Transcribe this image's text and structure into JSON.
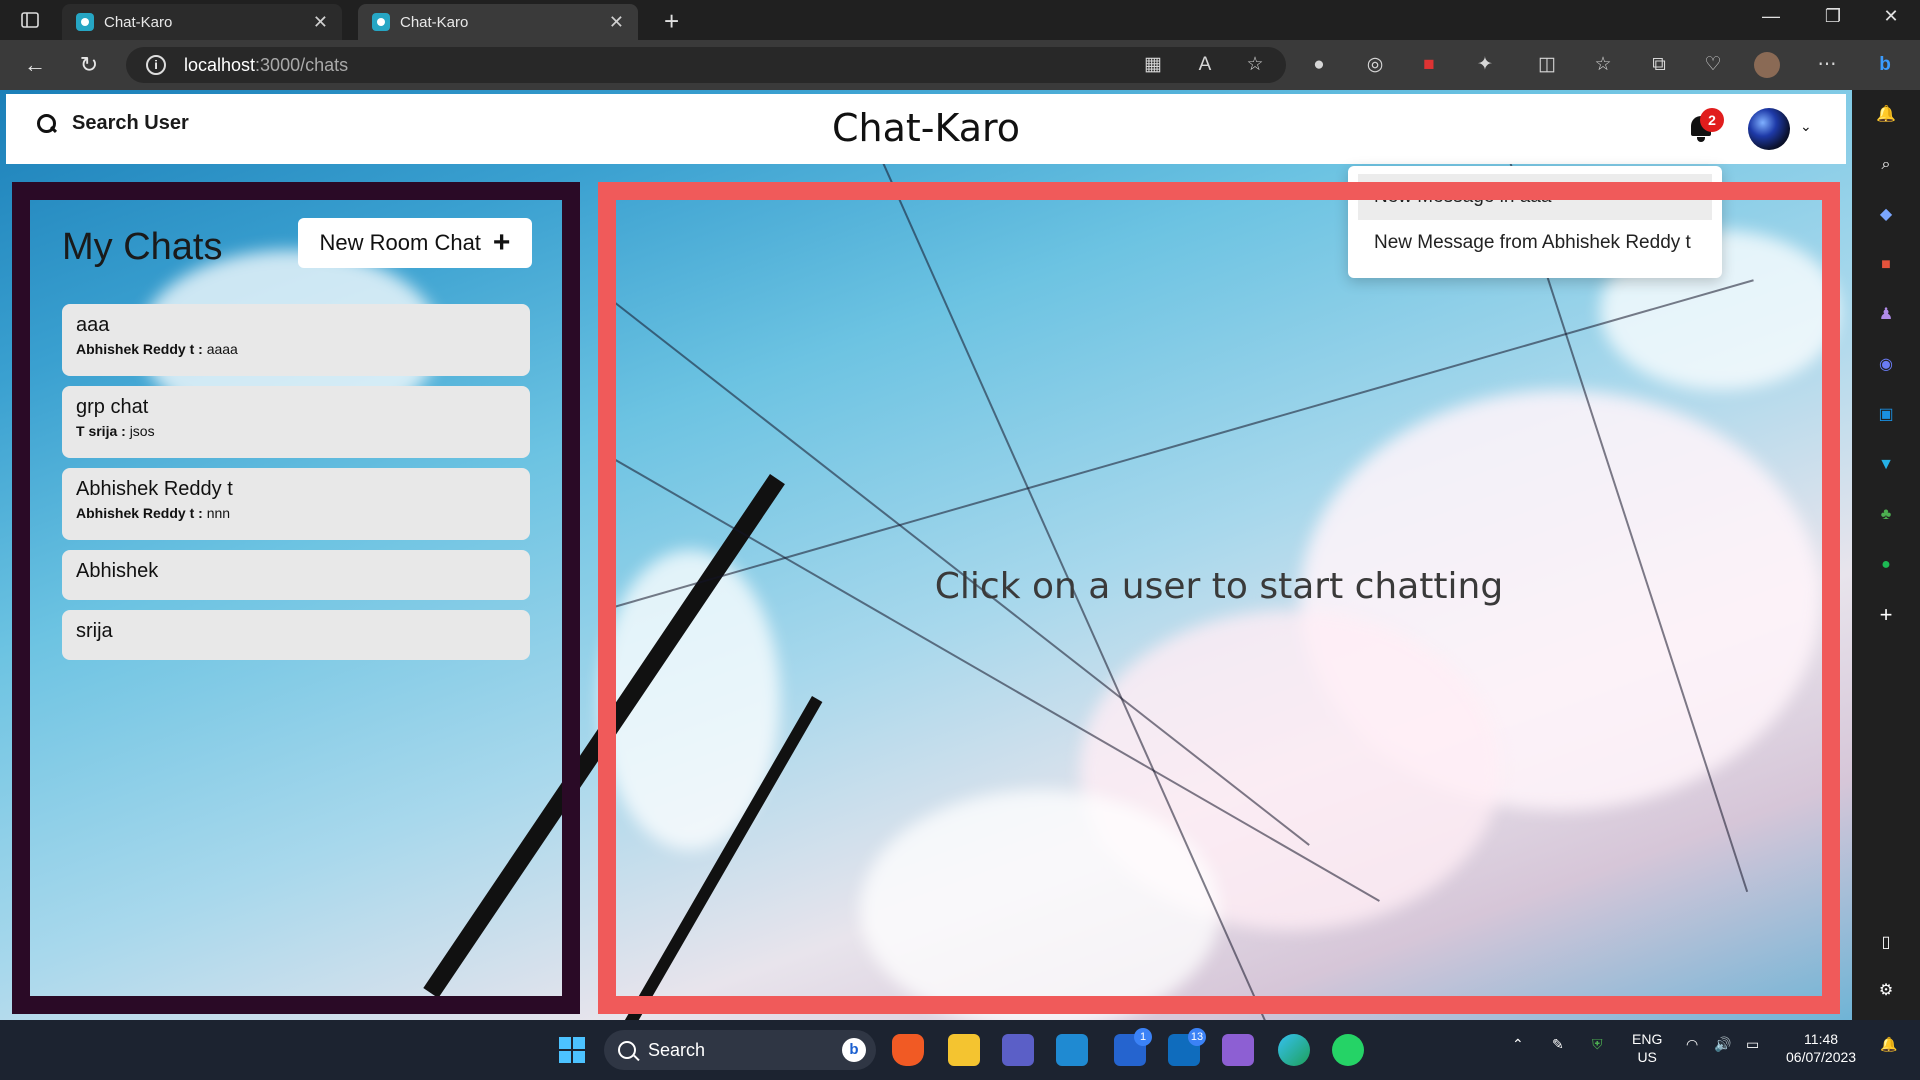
{
  "browser": {
    "tabs": [
      {
        "title": "Chat-Karo"
      },
      {
        "title": "Chat-Karo"
      }
    ],
    "url_host": "localhost",
    "url_path": ":3000/chats"
  },
  "header": {
    "search_label": "Search User",
    "brand": "Chat-Karo",
    "notification_count": "2"
  },
  "notifications": [
    {
      "text": "New Message in aaa"
    },
    {
      "text": "New Message from Abhishek Reddy t"
    }
  ],
  "sidebar": {
    "title": "My Chats",
    "new_room_label": "New Room Chat",
    "chats": [
      {
        "name": "aaa",
        "sender": "Abhishek Reddy t :",
        "message": "aaaa"
      },
      {
        "name": "grp chat",
        "sender": "T srija :",
        "message": "jsos"
      },
      {
        "name": "Abhishek Reddy t",
        "sender": "Abhishek Reddy t :",
        "message": "nnn"
      },
      {
        "name": "Abhishek"
      },
      {
        "name": "srija"
      }
    ]
  },
  "main": {
    "placeholder": "Click on a user to start chatting"
  },
  "taskbar": {
    "search_label": "Search",
    "todo_badge": "1",
    "mail_badge": "13",
    "lang": "ENG",
    "region": "US",
    "time": "11:48",
    "date": "06/07/2023"
  },
  "colors": {
    "left_border": "#2a0a26",
    "right_border": "#f05a5a",
    "badge": "#e11d1d"
  }
}
